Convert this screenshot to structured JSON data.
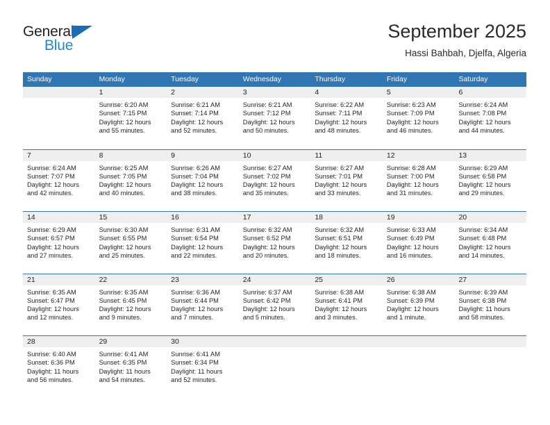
{
  "brand": {
    "name_part1": "General",
    "name_part2": "Blue",
    "accent_color": "#1f87d8",
    "triangle_color": "#1b6cb5"
  },
  "header": {
    "title": "September 2025",
    "location": "Hassi Bahbah, Djelfa, Algeria"
  },
  "theme": {
    "header_blue": "#3075b4",
    "daynum_band": "#efefef",
    "text": "#231f20"
  },
  "weekdays": [
    "Sunday",
    "Monday",
    "Tuesday",
    "Wednesday",
    "Thursday",
    "Friday",
    "Saturday"
  ],
  "weeks": [
    [
      {
        "day": "",
        "sunrise": "",
        "sunset": "",
        "daylight_line1": "",
        "daylight_line2": "",
        "empty": true
      },
      {
        "day": "1",
        "sunrise": "Sunrise: 6:20 AM",
        "sunset": "Sunset: 7:15 PM",
        "daylight_line1": "Daylight: 12 hours",
        "daylight_line2": "and 55 minutes."
      },
      {
        "day": "2",
        "sunrise": "Sunrise: 6:21 AM",
        "sunset": "Sunset: 7:14 PM",
        "daylight_line1": "Daylight: 12 hours",
        "daylight_line2": "and 52 minutes."
      },
      {
        "day": "3",
        "sunrise": "Sunrise: 6:21 AM",
        "sunset": "Sunset: 7:12 PM",
        "daylight_line1": "Daylight: 12 hours",
        "daylight_line2": "and 50 minutes."
      },
      {
        "day": "4",
        "sunrise": "Sunrise: 6:22 AM",
        "sunset": "Sunset: 7:11 PM",
        "daylight_line1": "Daylight: 12 hours",
        "daylight_line2": "and 48 minutes."
      },
      {
        "day": "5",
        "sunrise": "Sunrise: 6:23 AM",
        "sunset": "Sunset: 7:09 PM",
        "daylight_line1": "Daylight: 12 hours",
        "daylight_line2": "and 46 minutes."
      },
      {
        "day": "6",
        "sunrise": "Sunrise: 6:24 AM",
        "sunset": "Sunset: 7:08 PM",
        "daylight_line1": "Daylight: 12 hours",
        "daylight_line2": "and 44 minutes."
      }
    ],
    [
      {
        "day": "7",
        "sunrise": "Sunrise: 6:24 AM",
        "sunset": "Sunset: 7:07 PM",
        "daylight_line1": "Daylight: 12 hours",
        "daylight_line2": "and 42 minutes."
      },
      {
        "day": "8",
        "sunrise": "Sunrise: 6:25 AM",
        "sunset": "Sunset: 7:05 PM",
        "daylight_line1": "Daylight: 12 hours",
        "daylight_line2": "and 40 minutes."
      },
      {
        "day": "9",
        "sunrise": "Sunrise: 6:26 AM",
        "sunset": "Sunset: 7:04 PM",
        "daylight_line1": "Daylight: 12 hours",
        "daylight_line2": "and 38 minutes."
      },
      {
        "day": "10",
        "sunrise": "Sunrise: 6:27 AM",
        "sunset": "Sunset: 7:02 PM",
        "daylight_line1": "Daylight: 12 hours",
        "daylight_line2": "and 35 minutes."
      },
      {
        "day": "11",
        "sunrise": "Sunrise: 6:27 AM",
        "sunset": "Sunset: 7:01 PM",
        "daylight_line1": "Daylight: 12 hours",
        "daylight_line2": "and 33 minutes."
      },
      {
        "day": "12",
        "sunrise": "Sunrise: 6:28 AM",
        "sunset": "Sunset: 7:00 PM",
        "daylight_line1": "Daylight: 12 hours",
        "daylight_line2": "and 31 minutes."
      },
      {
        "day": "13",
        "sunrise": "Sunrise: 6:29 AM",
        "sunset": "Sunset: 6:58 PM",
        "daylight_line1": "Daylight: 12 hours",
        "daylight_line2": "and 29 minutes."
      }
    ],
    [
      {
        "day": "14",
        "sunrise": "Sunrise: 6:29 AM",
        "sunset": "Sunset: 6:57 PM",
        "daylight_line1": "Daylight: 12 hours",
        "daylight_line2": "and 27 minutes."
      },
      {
        "day": "15",
        "sunrise": "Sunrise: 6:30 AM",
        "sunset": "Sunset: 6:55 PM",
        "daylight_line1": "Daylight: 12 hours",
        "daylight_line2": "and 25 minutes."
      },
      {
        "day": "16",
        "sunrise": "Sunrise: 6:31 AM",
        "sunset": "Sunset: 6:54 PM",
        "daylight_line1": "Daylight: 12 hours",
        "daylight_line2": "and 22 minutes."
      },
      {
        "day": "17",
        "sunrise": "Sunrise: 6:32 AM",
        "sunset": "Sunset: 6:52 PM",
        "daylight_line1": "Daylight: 12 hours",
        "daylight_line2": "and 20 minutes."
      },
      {
        "day": "18",
        "sunrise": "Sunrise: 6:32 AM",
        "sunset": "Sunset: 6:51 PM",
        "daylight_line1": "Daylight: 12 hours",
        "daylight_line2": "and 18 minutes."
      },
      {
        "day": "19",
        "sunrise": "Sunrise: 6:33 AM",
        "sunset": "Sunset: 6:49 PM",
        "daylight_line1": "Daylight: 12 hours",
        "daylight_line2": "and 16 minutes."
      },
      {
        "day": "20",
        "sunrise": "Sunrise: 6:34 AM",
        "sunset": "Sunset: 6:48 PM",
        "daylight_line1": "Daylight: 12 hours",
        "daylight_line2": "and 14 minutes."
      }
    ],
    [
      {
        "day": "21",
        "sunrise": "Sunrise: 6:35 AM",
        "sunset": "Sunset: 6:47 PM",
        "daylight_line1": "Daylight: 12 hours",
        "daylight_line2": "and 12 minutes."
      },
      {
        "day": "22",
        "sunrise": "Sunrise: 6:35 AM",
        "sunset": "Sunset: 6:45 PM",
        "daylight_line1": "Daylight: 12 hours",
        "daylight_line2": "and 9 minutes."
      },
      {
        "day": "23",
        "sunrise": "Sunrise: 6:36 AM",
        "sunset": "Sunset: 6:44 PM",
        "daylight_line1": "Daylight: 12 hours",
        "daylight_line2": "and 7 minutes."
      },
      {
        "day": "24",
        "sunrise": "Sunrise: 6:37 AM",
        "sunset": "Sunset: 6:42 PM",
        "daylight_line1": "Daylight: 12 hours",
        "daylight_line2": "and 5 minutes."
      },
      {
        "day": "25",
        "sunrise": "Sunrise: 6:38 AM",
        "sunset": "Sunset: 6:41 PM",
        "daylight_line1": "Daylight: 12 hours",
        "daylight_line2": "and 3 minutes."
      },
      {
        "day": "26",
        "sunrise": "Sunrise: 6:38 AM",
        "sunset": "Sunset: 6:39 PM",
        "daylight_line1": "Daylight: 12 hours",
        "daylight_line2": "and 1 minute."
      },
      {
        "day": "27",
        "sunrise": "Sunrise: 6:39 AM",
        "sunset": "Sunset: 6:38 PM",
        "daylight_line1": "Daylight: 11 hours",
        "daylight_line2": "and 58 minutes."
      }
    ],
    [
      {
        "day": "28",
        "sunrise": "Sunrise: 6:40 AM",
        "sunset": "Sunset: 6:36 PM",
        "daylight_line1": "Daylight: 11 hours",
        "daylight_line2": "and 56 minutes."
      },
      {
        "day": "29",
        "sunrise": "Sunrise: 6:41 AM",
        "sunset": "Sunset: 6:35 PM",
        "daylight_line1": "Daylight: 11 hours",
        "daylight_line2": "and 54 minutes."
      },
      {
        "day": "30",
        "sunrise": "Sunrise: 6:41 AM",
        "sunset": "Sunset: 6:34 PM",
        "daylight_line1": "Daylight: 11 hours",
        "daylight_line2": "and 52 minutes."
      },
      {
        "day": "",
        "sunrise": "",
        "sunset": "",
        "daylight_line1": "",
        "daylight_line2": "",
        "empty": true
      },
      {
        "day": "",
        "sunrise": "",
        "sunset": "",
        "daylight_line1": "",
        "daylight_line2": "",
        "empty": true
      },
      {
        "day": "",
        "sunrise": "",
        "sunset": "",
        "daylight_line1": "",
        "daylight_line2": "",
        "empty": true
      },
      {
        "day": "",
        "sunrise": "",
        "sunset": "",
        "daylight_line1": "",
        "daylight_line2": "",
        "empty": true
      }
    ]
  ]
}
